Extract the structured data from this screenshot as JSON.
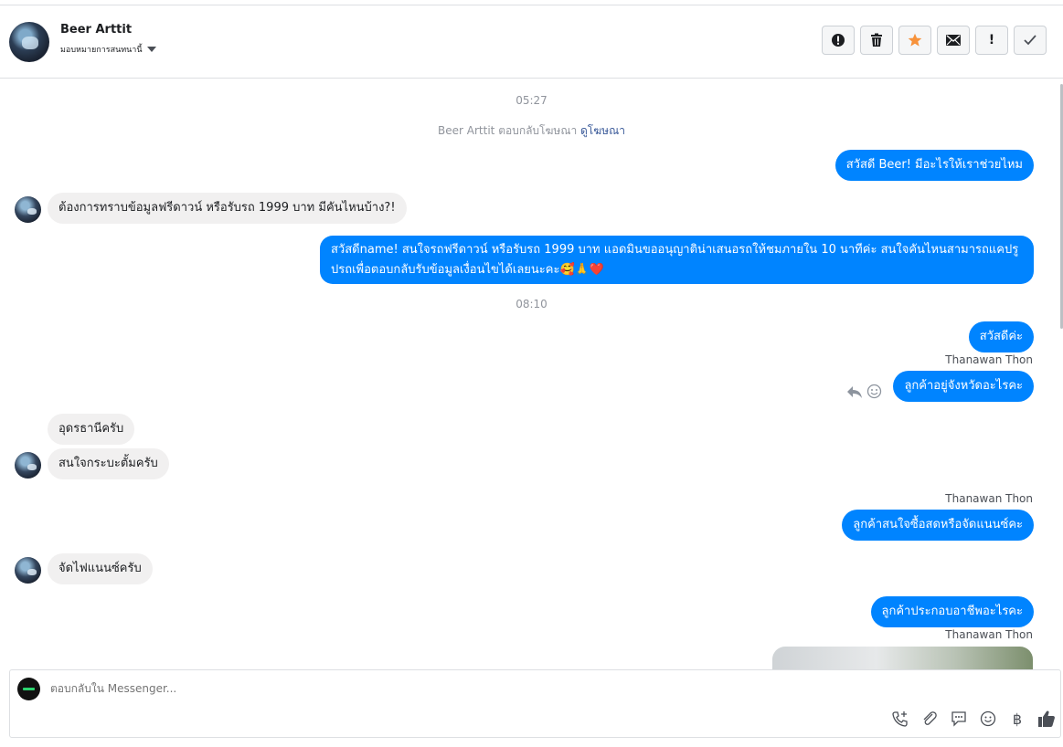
{
  "header": {
    "contact_name": "Beer Arttit",
    "assign_label": "มอบหมายการสนทนานี้",
    "actions": [
      {
        "name": "report-spam-button",
        "icon": "alert-circle-icon"
      },
      {
        "name": "delete-button",
        "icon": "trash-icon"
      },
      {
        "name": "star-button",
        "icon": "star-icon",
        "color": "#f7923b"
      },
      {
        "name": "mark-unread-button",
        "icon": "envelope-icon"
      },
      {
        "name": "mark-important-button",
        "icon": "exclamation-icon",
        "text": "!"
      },
      {
        "name": "mark-done-button",
        "icon": "check-icon"
      }
    ]
  },
  "conversation": {
    "time_1": "05:27",
    "system_text": "Beer Arttit ตอบกลับโฆษณา",
    "system_link": "ดูโฆษณา",
    "msg_out_1": "สวัสดี Beer! มีอะไรให้เราช่วยไหม",
    "msg_in_1": "ต้องการทราบข้อมูลฟรีดาวน์ หรือรับรถ 1999 บาท มีคันไหนบ้าง?!",
    "msg_out_2": "สวัสดีname! สนใจรถฟรีดาวน์ หรือรับรถ 1999 บาท แอดมินขออนุญาติน่าเสนอรถให้ชมภายใน 10 นาทีค่ะ สนใจคันไหนสามารถแคปรูปรถเพื่อตอบกลับรับข้อมูลเงื่อนไขได้เลยนะคะ🥰🙏❤️",
    "time_2": "08:10",
    "msg_out_3": "สวัสดีค่ะ",
    "sender_1": "Thanawan Thon",
    "msg_out_4": "ลูกค้าอยู่จังหวัดอะไรคะ",
    "msg_in_2": "อุดรธานีครับ",
    "msg_in_3": "สนใจกระบะตั้มครับ",
    "sender_2": "Thanawan Thon",
    "msg_out_5": "ลูกค้าสนใจซื้อสดหรือจัดแนนซ์คะ",
    "msg_in_4": "จัดไฟแนนซ์ครับ",
    "msg_out_6": "ลูกค้าประกอบอาชีพอะไรคะ",
    "sender_3": "Thanawan Thon"
  },
  "composer": {
    "placeholder": "ตอบกลับใน Messenger...",
    "tools": [
      "phone-add-icon",
      "paperclip-icon",
      "saved-reply-icon",
      "emoji-icon",
      "baht-icon",
      "thumbs-up-icon"
    ],
    "baht_symbol": "฿"
  }
}
